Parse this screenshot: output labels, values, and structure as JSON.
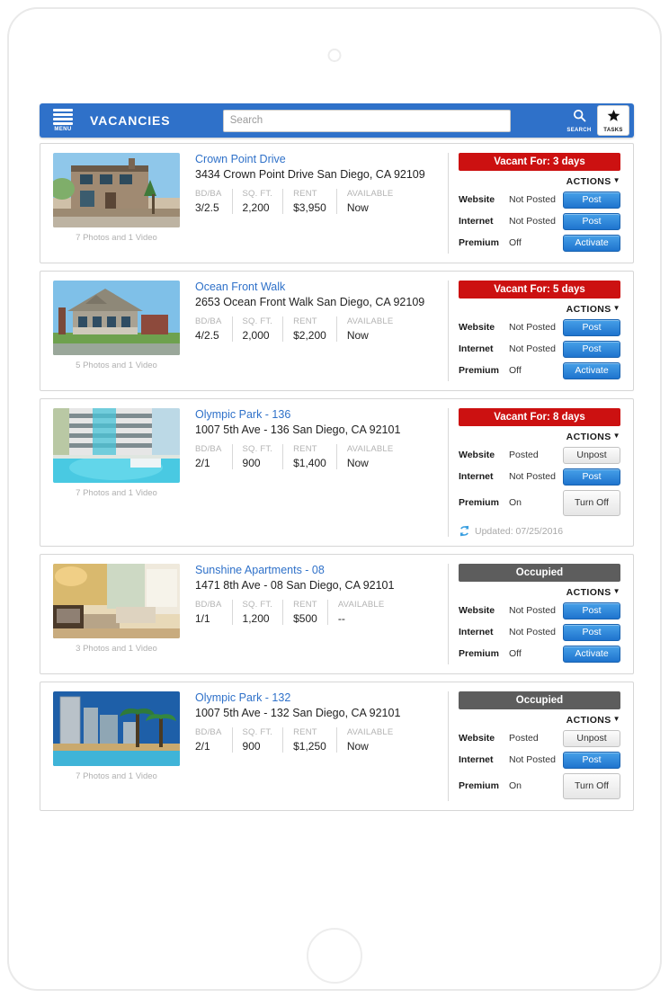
{
  "device": {
    "camera": "camera-dot",
    "home_button": "home-button"
  },
  "topbar": {
    "menu_label": "MENU",
    "title": "VACANCIES",
    "search_placeholder": "Search",
    "search_value": "",
    "search_label": "SEARCH",
    "tasks_label": "TASKS",
    "accent_color": "#2f71c9"
  },
  "spec_headers": {
    "bdba": "BD/BA",
    "sqft": "SQ. FT.",
    "rent": "RENT",
    "available": "AVAILABLE"
  },
  "labels": {
    "actions": "ACTIONS",
    "caret": "▼",
    "website": "Website",
    "internet": "Internet",
    "premium": "Premium"
  },
  "colors": {
    "vacant": "#cc1111",
    "occupied": "#5d5d5d",
    "link": "#2f71c9",
    "primary_button": "#1f74ce"
  },
  "listings": [
    {
      "name": "Crown Point Drive",
      "address": "3434 Crown Point Drive San Diego, CA 92109",
      "media_caption": "7 Photos and 1 Video",
      "photo_kind": "house-exterior-two-story",
      "bdba": "3/2.5",
      "sqft": "2,200",
      "rent": "$3,950",
      "available": "Now",
      "status_text": "Vacant For: 3 days",
      "status_type": "vacant",
      "website_state": "Not Posted",
      "website_action": "Post",
      "website_action_style": "primary",
      "internet_state": "Not Posted",
      "internet_action": "Post",
      "internet_action_style": "primary",
      "premium_state": "Off",
      "premium_action": "Activate",
      "premium_action_style": "primary",
      "updated": ""
    },
    {
      "name": "Ocean Front Walk",
      "address": "2653 Ocean Front Walk San Diego, CA 92109",
      "media_caption": "5 Photos and 1 Video",
      "photo_kind": "house-victorian",
      "bdba": "4/2.5",
      "sqft": "2,000",
      "rent": "$2,200",
      "available": "Now",
      "status_text": "Vacant For: 5 days",
      "status_type": "vacant",
      "website_state": "Not Posted",
      "website_action": "Post",
      "website_action_style": "primary",
      "internet_state": "Not Posted",
      "internet_action": "Post",
      "internet_action_style": "primary",
      "premium_state": "Off",
      "premium_action": "Activate",
      "premium_action_style": "primary",
      "updated": ""
    },
    {
      "name": "Olympic Park - 136",
      "address": "1007 5th Ave - 136 San Diego, CA 92101",
      "media_caption": "7 Photos and 1 Video",
      "photo_kind": "condo-pool",
      "bdba": "2/1",
      "sqft": "900",
      "rent": "$1,400",
      "available": "Now",
      "status_text": "Vacant For: 8 days",
      "status_type": "vacant",
      "website_state": "Posted",
      "website_action": "Unpost",
      "website_action_style": "neutral",
      "internet_state": "Not Posted",
      "internet_action": "Post",
      "internet_action_style": "primary",
      "premium_state": "On",
      "premium_action": "Turn Off",
      "premium_action_style": "neutral",
      "updated": "Updated: 07/25/2016"
    },
    {
      "name": "Sunshine Apartments - 08",
      "address": "1471 8th Ave - 08 San Diego, CA 92101",
      "media_caption": "3 Photos and 1 Video",
      "photo_kind": "interior-living-room",
      "bdba": "1/1",
      "sqft": "1,200",
      "rent": "$500",
      "available": "--",
      "status_text": "Occupied",
      "status_type": "occupied",
      "website_state": "Not Posted",
      "website_action": "Post",
      "website_action_style": "primary",
      "internet_state": "Not Posted",
      "internet_action": "Post",
      "internet_action_style": "primary",
      "premium_state": "Off",
      "premium_action": "Activate",
      "premium_action_style": "primary",
      "updated": ""
    },
    {
      "name": "Olympic Park - 132",
      "address": "1007 5th Ave - 132 San Diego, CA 92101",
      "media_caption": "7 Photos and 1 Video",
      "photo_kind": "highrise-palms",
      "bdba": "2/1",
      "sqft": "900",
      "rent": "$1,250",
      "available": "Now",
      "status_text": "Occupied",
      "status_type": "occupied",
      "website_state": "Posted",
      "website_action": "Unpost",
      "website_action_style": "neutral",
      "internet_state": "Not Posted",
      "internet_action": "Post",
      "internet_action_style": "primary",
      "premium_state": "On",
      "premium_action": "Turn Off",
      "premium_action_style": "neutral",
      "updated": ""
    }
  ]
}
